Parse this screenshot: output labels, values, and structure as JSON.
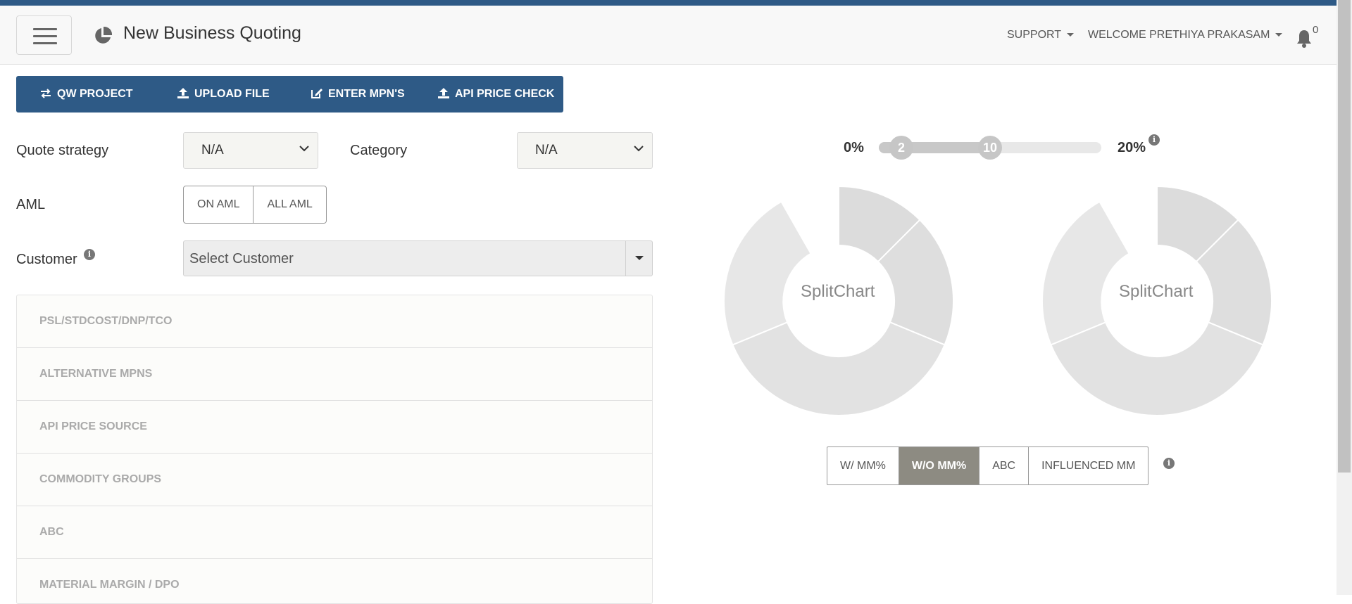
{
  "header": {
    "app_title": "New Business Quoting",
    "support_label": "SUPPORT",
    "welcome_label": "WELCOME PRETHIYA PRAKASAM",
    "notification_count": "0"
  },
  "actions": {
    "qw_project": "QW PROJECT",
    "upload_file": "UPLOAD FILE",
    "enter_mpns": "ENTER MPN'S",
    "api_price_check": "API PRICE CHECK"
  },
  "form": {
    "quote_strategy_label": "Quote strategy",
    "quote_strategy_value": "N/A",
    "category_label": "Category",
    "category_value": "N/A",
    "aml_label": "AML",
    "aml_options": [
      "ON AML",
      "ALL AML"
    ],
    "customer_label": "Customer",
    "customer_placeholder": "Select Customer"
  },
  "accordion": [
    "PSL/STDCOST/DNP/TCO",
    "ALTERNATIVE MPNS",
    "API PRICE SOURCE",
    "COMMODITY GROUPS",
    "ABC",
    "MATERIAL MARGIN / DPO"
  ],
  "slider": {
    "min_label": "0%",
    "max_label": "20%",
    "low_value": "2",
    "high_value": "10"
  },
  "charts": [
    {
      "label": "SplitChart",
      "colors": [
        "#dcdcdc",
        "#dedede",
        "#e2e2e2",
        "#e7e7e7"
      ]
    },
    {
      "label": "SplitChart",
      "colors": [
        "#dcdcdc",
        "#dedede",
        "#e2e2e2",
        "#e7e7e7"
      ]
    }
  ],
  "toggles": [
    "W/ MM%",
    "W/O MM%",
    "ABC",
    "INFLUENCED MM"
  ],
  "active_toggle": "W/O MM%",
  "colors": {
    "brand": "#2e5a86",
    "active_toggle": "#8d8b82"
  },
  "icons": [
    "hamburger-icon",
    "pie-chart-icon",
    "bell-icon",
    "exchange-icon",
    "upload-icon",
    "edit-icon",
    "info-icon"
  ]
}
